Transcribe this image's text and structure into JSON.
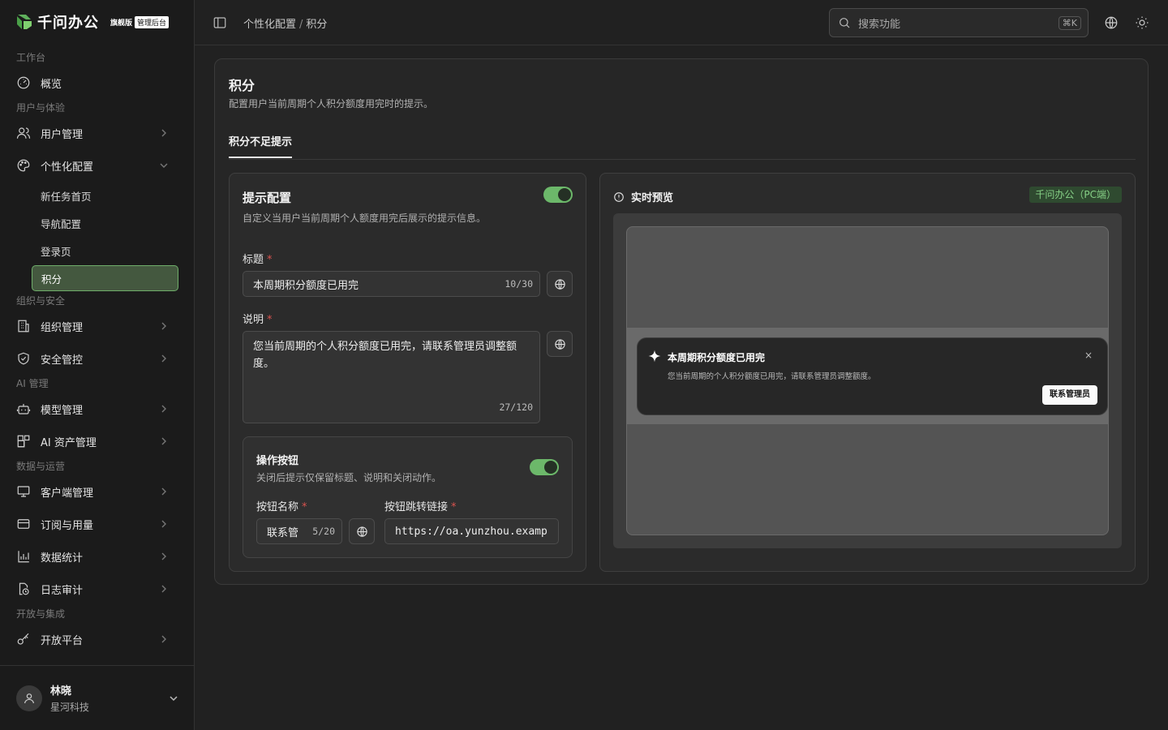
{
  "brand": {
    "name": "千问办公",
    "edition": "旗舰版",
    "badge": "管理后台"
  },
  "nav": {
    "groups": {
      "workspace": "工作台",
      "user_exp": "用户与体验",
      "org_sec": "组织与安全",
      "ai": "AI 管理",
      "data_ops": "数据与运营",
      "open": "开放与集成"
    },
    "items": {
      "overview": "概览",
      "users": "用户管理",
      "personalize": "个性化配置",
      "new_task_home": "新任务首页",
      "nav_config": "导航配置",
      "login_page": "登录页",
      "points": "积分",
      "org": "组织管理",
      "security": "安全管控",
      "models": "模型管理",
      "ai_assets": "AI 资产管理",
      "clients": "客户端管理",
      "subscription": "订阅与用量",
      "stats": "数据统计",
      "audit": "日志审计",
      "open_platform": "开放平台"
    }
  },
  "user": {
    "name": "林晓",
    "org": "星河科技"
  },
  "topbar": {
    "breadcrumb": [
      "个性化配置",
      "积分"
    ],
    "breadcrumb_sep": "/",
    "search_placeholder": "搜索功能",
    "shortcut": "⌘K"
  },
  "page": {
    "title": "积分",
    "description": "配置用户当前周期个人积分额度用完时的提示。",
    "tab": "积分不足提示"
  },
  "config": {
    "title": "提示配置",
    "description": "自定义当用户当前周期个人额度用完后展示的提示信息。",
    "enabled": true,
    "title_label": "标题",
    "title_value": "本周期积分额度已用完",
    "title_count": "10/30",
    "desc_label": "说明",
    "desc_value": "您当前周期的个人积分额度已用完，请联系管理员调整额度。",
    "desc_count": "27/120",
    "required_mark": "*",
    "action": {
      "title": "操作按钮",
      "description": "关闭后提示仅保留标题、说明和关闭动作。",
      "enabled": true,
      "name_label": "按钮名称",
      "name_value": "联系管",
      "name_count": "5/20",
      "link_label": "按钮跳转链接",
      "link_value": "https://oa.yunzhou.examp"
    }
  },
  "preview": {
    "title": "实时预览",
    "tag": "千问办公（PC端）",
    "toast_title": "本周期积分额度已用完",
    "toast_desc": "您当前周期的个人积分额度已用完，请联系管理员调整额度。",
    "toast_close": "×",
    "toast_button": "联系管理员"
  },
  "colors": {
    "accent": "#6cb86a",
    "active_bg": "#44583f",
    "tag_text": "#86d086"
  }
}
